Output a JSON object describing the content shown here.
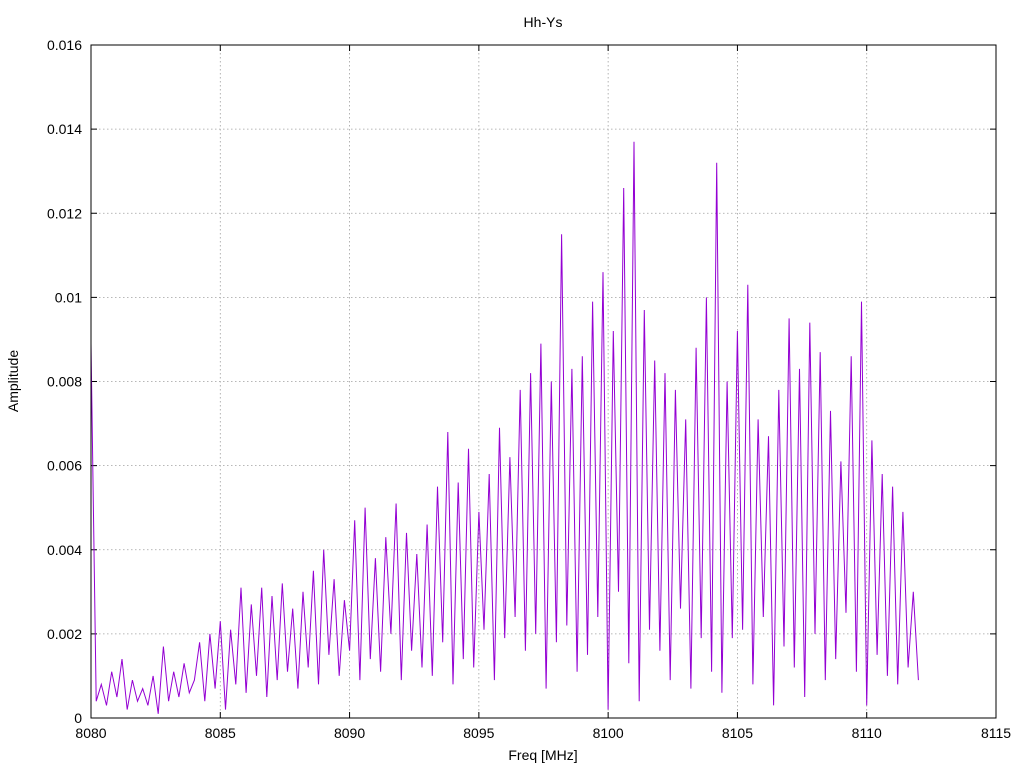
{
  "chart_data": {
    "type": "line",
    "title": "Hh-Ys",
    "xlabel": "Freq [MHz]",
    "ylabel": "Amplitude",
    "xlim": [
      8080,
      8115
    ],
    "ylim": [
      0,
      0.016
    ],
    "grid": true,
    "line_color": "#9400D3",
    "x_ticks": [
      "8080",
      "8085",
      "8090",
      "8095",
      "8100",
      "8105",
      "8110",
      "8115"
    ],
    "y_ticks": [
      "0",
      "0.002",
      "0.004",
      "0.006",
      "0.008",
      "0.01",
      "0.012",
      "0.014",
      "0.016"
    ],
    "x_start": 8080,
    "x_step": 0.2,
    "values": [
      0.0089,
      0.0004,
      0.0008,
      0.0003,
      0.0011,
      0.0005,
      0.0014,
      0.0002,
      0.0009,
      0.0004,
      0.0007,
      0.0003,
      0.001,
      0.0001,
      0.0017,
      0.0004,
      0.0011,
      0.0005,
      0.0013,
      0.0006,
      0.0009,
      0.0018,
      0.0004,
      0.002,
      0.0007,
      0.0023,
      0.0002,
      0.0021,
      0.0008,
      0.0031,
      0.0006,
      0.0027,
      0.001,
      0.0031,
      0.0005,
      0.0029,
      0.0009,
      0.0032,
      0.0011,
      0.0026,
      0.0007,
      0.003,
      0.0012,
      0.0035,
      0.0008,
      0.004,
      0.0015,
      0.0033,
      0.001,
      0.0028,
      0.0016,
      0.0047,
      0.0009,
      0.005,
      0.0014,
      0.0038,
      0.0011,
      0.0043,
      0.002,
      0.0051,
      0.0009,
      0.0044,
      0.0016,
      0.0039,
      0.0012,
      0.0046,
      0.001,
      0.0055,
      0.0018,
      0.0068,
      0.0008,
      0.0056,
      0.0014,
      0.0064,
      0.0012,
      0.0049,
      0.0021,
      0.0058,
      0.0009,
      0.0069,
      0.0019,
      0.0062,
      0.0024,
      0.0078,
      0.0016,
      0.0082,
      0.002,
      0.0089,
      0.0007,
      0.008,
      0.0018,
      0.0115,
      0.0022,
      0.0083,
      0.0011,
      0.0086,
      0.0015,
      0.0099,
      0.0024,
      0.0106,
      0.0002,
      0.0092,
      0.003,
      0.0126,
      0.0013,
      0.0137,
      0.0004,
      0.0097,
      0.0021,
      0.0085,
      0.0016,
      0.0082,
      0.0009,
      0.0078,
      0.0026,
      0.0071,
      0.0007,
      0.0088,
      0.0019,
      0.01,
      0.0011,
      0.0132,
      0.0006,
      0.008,
      0.0019,
      0.0092,
      0.0021,
      0.0103,
      0.0008,
      0.0071,
      0.0024,
      0.0067,
      0.0003,
      0.0078,
      0.0017,
      0.0095,
      0.0012,
      0.0083,
      0.0005,
      0.0094,
      0.002,
      0.0087,
      0.0009,
      0.0073,
      0.0014,
      0.0061,
      0.0025,
      0.0086,
      0.0011,
      0.0099,
      0.0003,
      0.0066,
      0.0015,
      0.0058,
      0.001,
      0.0055,
      0.0008,
      0.0049,
      0.0012,
      0.003,
      0.0009
    ]
  }
}
